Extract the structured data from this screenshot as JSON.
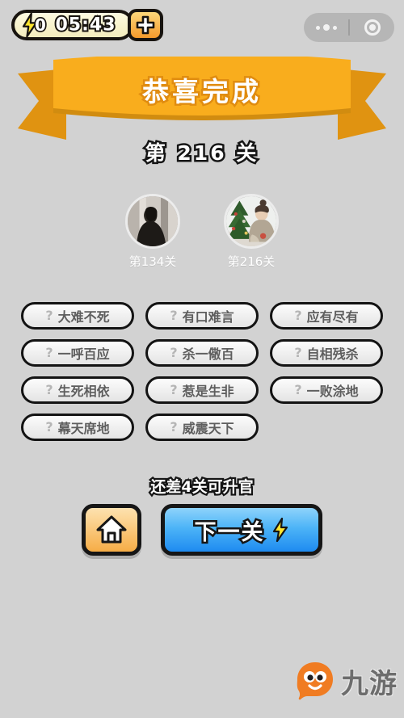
{
  "topbar": {
    "energy_count": "0",
    "timer": "05:43",
    "add_label": "+",
    "bolt_icon": "lightning-bolt-icon",
    "wechat_more_icon": "more-dots-icon",
    "wechat_target_icon": "target-circle-icon"
  },
  "banner": {
    "title": "恭喜完成"
  },
  "level": {
    "label": "第 216 关"
  },
  "avatars": [
    {
      "caption": "第134关",
      "name": "avatar-level-134"
    },
    {
      "caption": "第216关",
      "name": "avatar-level-216"
    }
  ],
  "chips": [
    {
      "marker": "?",
      "text": "大难不死"
    },
    {
      "marker": "?",
      "text": "有口难言"
    },
    {
      "marker": "?",
      "text": "应有尽有"
    },
    {
      "marker": "?",
      "text": "一呼百应"
    },
    {
      "marker": "?",
      "text": "杀一儆百"
    },
    {
      "marker": "?",
      "text": "自相残杀"
    },
    {
      "marker": "?",
      "text": "生死相依"
    },
    {
      "marker": "?",
      "text": "惹是生非"
    },
    {
      "marker": "?",
      "text": "一败涂地"
    },
    {
      "marker": "?",
      "text": "幕天席地"
    },
    {
      "marker": "?",
      "text": "威震天下"
    }
  ],
  "promo": {
    "text": "还差4关可升官"
  },
  "actions": {
    "home_icon": "home-icon",
    "next_label": "下一关",
    "next_bolt_icon": "lightning-bolt-icon"
  },
  "watermark": {
    "text": "九游",
    "mascot_icon": "mascot-icon"
  },
  "colors": {
    "background": "#d2d2d2",
    "banner_orange": "#f5a81c",
    "banner_orange_dark": "#dd8f0c",
    "outline_black": "#151515",
    "next_blue": "#2f9ef5",
    "home_orange": "#f6ad46",
    "chip_face": "#f1f1f1",
    "chip_text": "#5e5e5e",
    "bolt_yellow": "#ffe62e",
    "mascot_orange": "#f07c22"
  }
}
